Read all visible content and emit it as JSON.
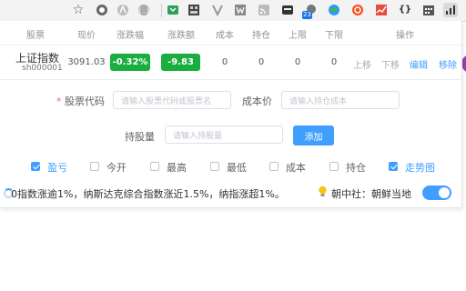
{
  "toolbar": {
    "star_icon": "☆",
    "badge_count": "23"
  },
  "table": {
    "headers": [
      "股票",
      "现价",
      "涨跌幅",
      "涨跌额",
      "成本",
      "持仓",
      "上限",
      "下限",
      "操作"
    ],
    "row": {
      "name": "上证指数",
      "code": "sh000001",
      "price": "3091.03",
      "change_pct": "-0.32%",
      "change_amt": "-9.83",
      "cost": "0",
      "holding": "0",
      "upper": "0",
      "lower": "0",
      "actions": [
        "上移",
        "下移",
        "编辑",
        "移除"
      ]
    }
  },
  "form": {
    "code_label": "股票代码",
    "code_placeholder": "请输入股票代码或股票名",
    "cost_label": "成本价",
    "cost_placeholder": "请输入持仓成本",
    "qty_label": "持股量",
    "qty_placeholder": "请输入持股量",
    "add_label": "添加"
  },
  "options": [
    {
      "label": "盈亏",
      "checked": true
    },
    {
      "label": "今开",
      "checked": false
    },
    {
      "label": "最高",
      "checked": false
    },
    {
      "label": "最低",
      "checked": false
    },
    {
      "label": "成本",
      "checked": false
    },
    {
      "label": "持仓",
      "checked": false
    },
    {
      "label": "走势图",
      "checked": true
    }
  ],
  "ticker_text": "0指数涨逾1%，纳斯达克综合指数涨近1.5%，纳指涨超1%。",
  "news_text": "朝中社：朝鲜当地",
  "colors": {
    "accent": "#409eff",
    "down_green": "#1aad3f"
  }
}
